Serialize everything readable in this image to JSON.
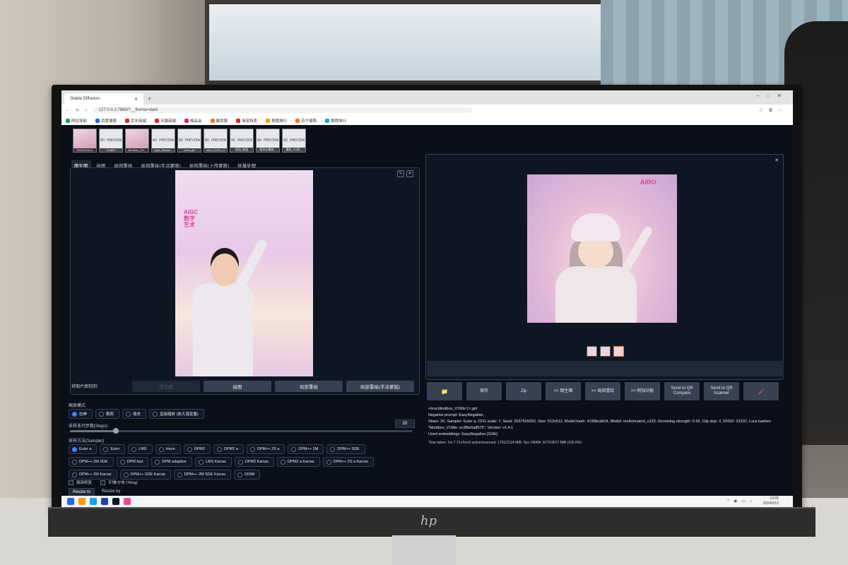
{
  "browser": {
    "tab_title": "Stable Diffusion",
    "url": "127.0.0.1:7860/?__theme=dark",
    "bookmarks": [
      "阿拉导航",
      "百度搜索",
      "京东商城",
      "天猫商城",
      "唯品会",
      "聚划算",
      "淘宝特卖",
      "携程旅行",
      "苏宁易购",
      "携程旅行"
    ]
  },
  "gallery": [
    {
      "label": "20240116-e1",
      "preview": false
    },
    {
      "label": "214667",
      "preview": true
    },
    {
      "label": "blindbox_V1...",
      "preview": false
    },
    {
      "label": "Light_Master...",
      "preview": true
    },
    {
      "label": "pixar-girl",
      "preview": true
    },
    {
      "label": "robot_0316_v1",
      "preview": true
    },
    {
      "label": "国风_插画",
      "preview": true
    },
    {
      "label": "国风水墨画...",
      "preview": true
    },
    {
      "label": "墨韵_SD版...",
      "preview": true
    }
  ],
  "no_preview_text": "NO PREVIEW",
  "tabs": [
    "图生图",
    "绘图",
    "局部重绘",
    "局部重绘(手涂蒙版)",
    "局部重绘(上传蒙版)",
    "批量处理"
  ],
  "copy_to": {
    "label": "将图片复制到:",
    "buttons": [
      "图生图",
      "绘图",
      "局部重绘",
      "局部重绘(手涂蒙版)"
    ]
  },
  "resize_mode": {
    "label": "缩放模式",
    "options": [
      "拉伸",
      "裁剪",
      "填充",
      "直接缩放 (放大潜变量)"
    ],
    "selected": "拉伸"
  },
  "steps": {
    "label": "采样迭代步数(Steps)",
    "value": "20",
    "fraction": 0.135
  },
  "sampler": {
    "label": "采样方法(Sampler)",
    "options": [
      "Euler a",
      "Euler",
      "LMS",
      "Heun",
      "DPM2",
      "DPM2 a",
      "DPM++ 2S a",
      "DPM++ 2M",
      "DPM++ SDE",
      "DPM++ 2M SDE",
      "DPM fast",
      "DPM adaptive",
      "LMS Karras",
      "DPM2 Karras",
      "DPM2 a Karras",
      "DPM++ 2S a Karras",
      "DPM++ 2M Karras",
      "DPM++ SDE Karras",
      "DPM++ 2M SDE Karras",
      "DDIM"
    ],
    "selected": "Euler a"
  },
  "checkboxes": {
    "restore_faces": "面部修复",
    "tiling": "平铺/分块 (Tiling)"
  },
  "resize_tabs": [
    "Resize to",
    "Resize by"
  ],
  "actions": [
    {
      "label": "",
      "icon": "folder-icon"
    },
    {
      "label": "保存"
    },
    {
      "label": "Zip"
    },
    {
      "label": ">> 图生图"
    },
    {
      "label": ">> 局部重绘"
    },
    {
      "label": ">> 附加功能"
    },
    {
      "label": "Send to QR Compare"
    },
    {
      "label": "Send to QR Scanner"
    },
    {
      "label": "",
      "icon": "paint-icon"
    }
  ],
  "output_info": {
    "prompt": "<lora:blindbox_V1Mix:1>,girl",
    "negative": "Negative prompt: EasyNegative,",
    "params": "Steps: 20, Sampler: Euler a, CFG scale: 7, Seed: 2037509252, Size: 512x512, Model hash: 4199bcdd14, Model: revAnimated_v122, Denoising strength: 0.39, Clip skip: 2, ENSD: 31337, Lora hashes: \"blindbox_V1Mix: ec3fbe5a8576\", Version: v1.4.1",
    "embeddings": "Used embeddings: EasyNegative [119b]",
    "time": "Time taken: 1m 7.71sTorch active/reserved: 1761/2124 MiB, Sys VRAM: 3072/3072 MiB (100.0%)"
  },
  "taskbar": {
    "time": "13:05",
    "date": "2024/3/12"
  },
  "brand": "hp",
  "colors": {
    "accent": "#ff7c00",
    "app_bg": "#0b0f19",
    "button": "#374151",
    "selected_radio": "#3b82f6"
  }
}
